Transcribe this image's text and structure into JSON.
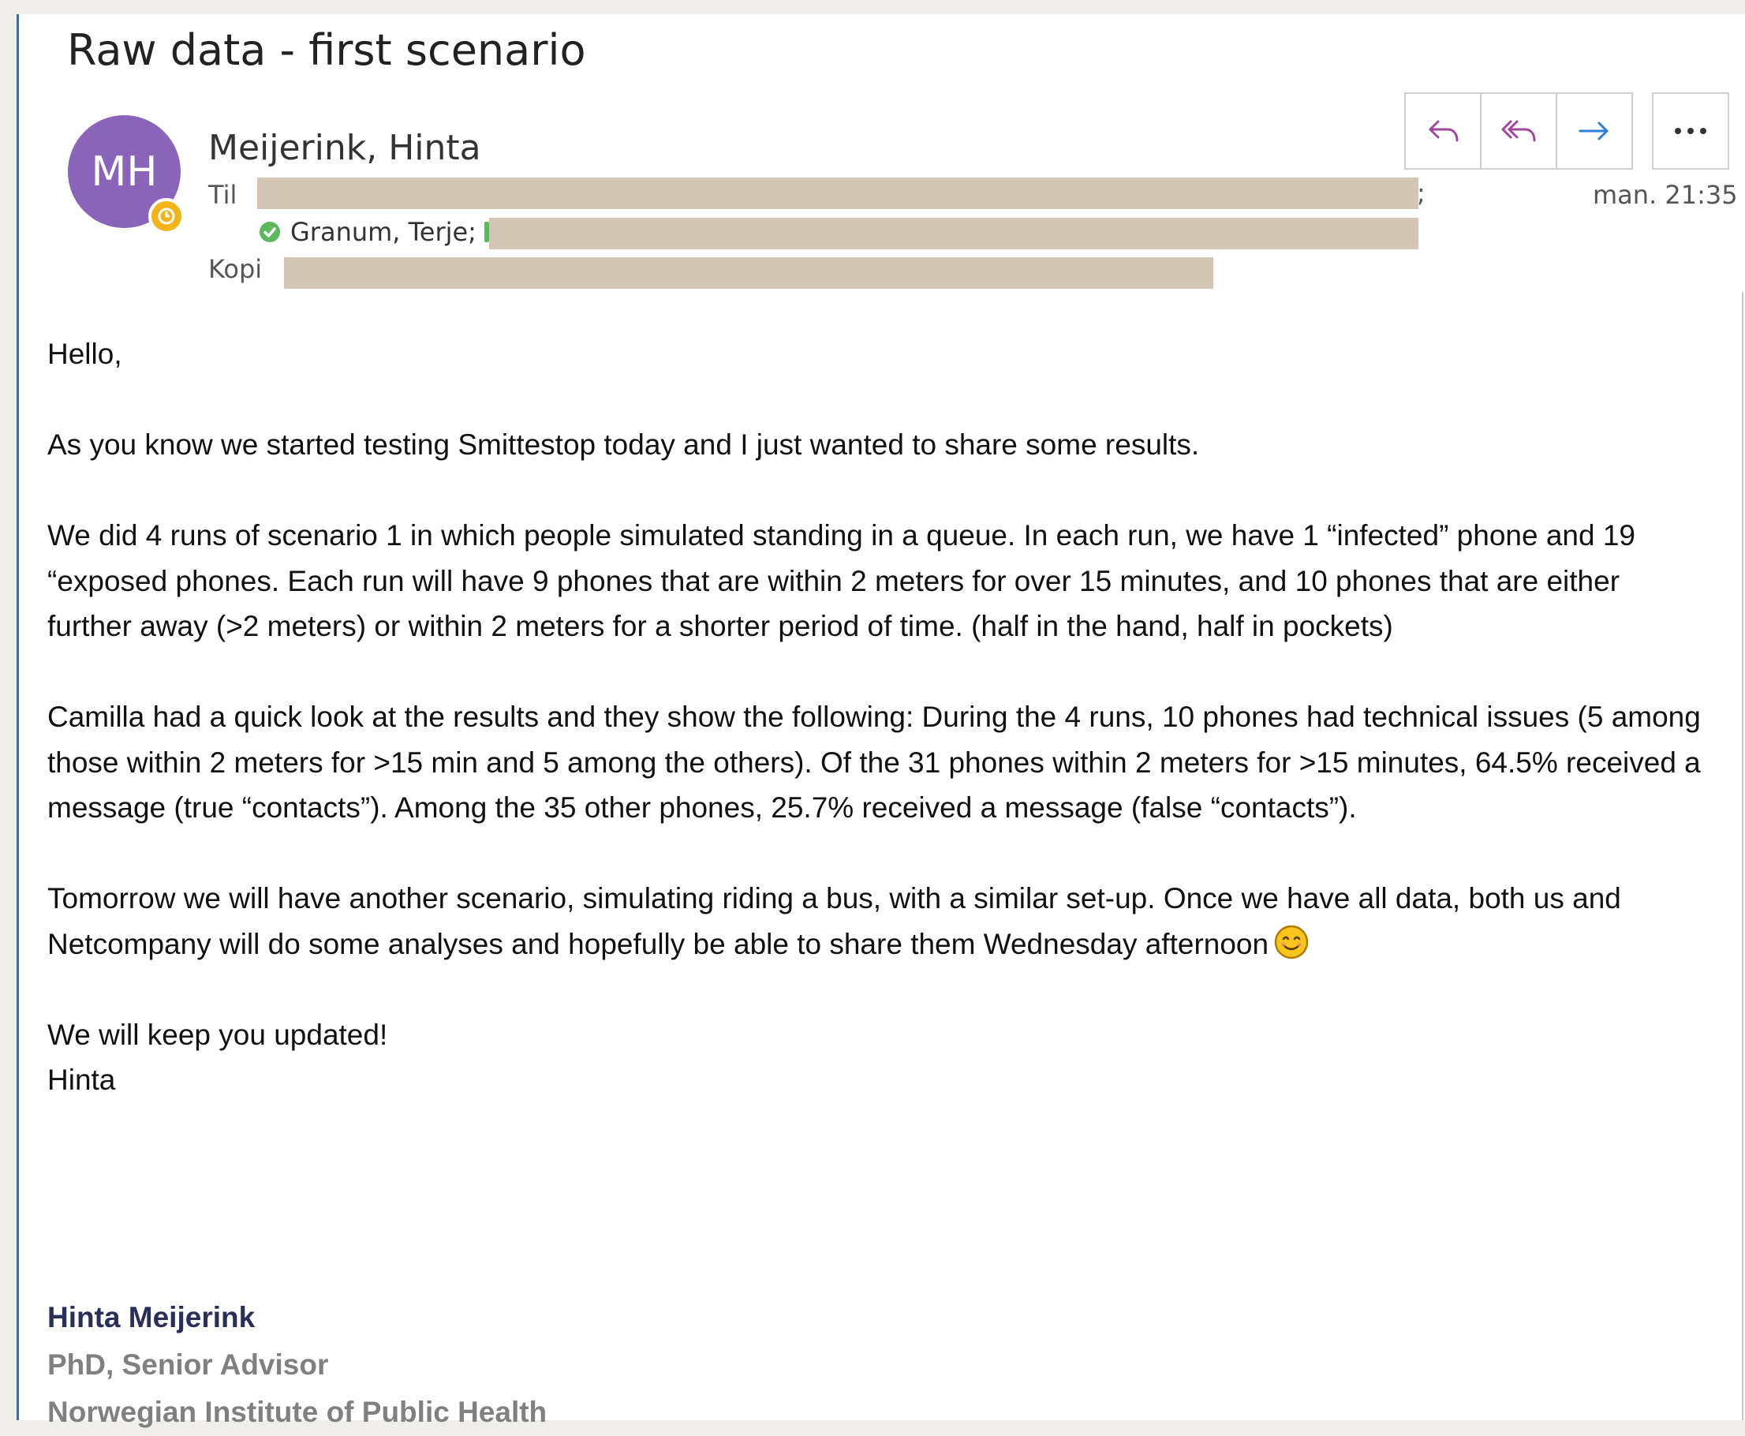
{
  "email": {
    "subject": "Raw data - first scenario",
    "avatar_initials": "MH",
    "sender": "Meijerink, Hinta",
    "to_label": "Til",
    "cc_label": "Kopi",
    "recipient_visible": "Granum, Terje;",
    "to_separator": ";",
    "date": "man. 21:35",
    "actions": {
      "reply_icon": "reply-icon",
      "reply_all_icon": "reply-all-icon",
      "forward_icon": "forward-icon",
      "more_icon": "more-options-icon"
    },
    "accent_color": "#8a64b8",
    "action_colors": {
      "reply": "#a0469e",
      "reply_all": "#a0469e",
      "forward": "#2b7fd4"
    }
  },
  "body": {
    "greeting": "Hello,",
    "p1": "As you know we started testing Smittestop today and I just wanted to share some results.",
    "p2": "We did 4 runs of scenario 1 in which people simulated standing in a queue. In each run, we have 1 “infected” phone and 19 “exposed phones. Each run will have 9 phones that are within 2 meters for over 15 minutes, and 10 phones that are either further away (>2 meters) or within 2 meters for a shorter period of time. (half in the hand, half in pockets)",
    "p3": "Camilla had a quick look at the results and they show the following: During the 4 runs, 10 phones had technical issues (5 among those within 2 meters for >15 min and 5 among the others). Of the 31 phones within 2 meters for >15 minutes, 64.5% received a message (true “contacts”). Among the 35 other phones, 25.7% received a message (false “contacts”).",
    "p4": "Tomorrow we will have another scenario, simulating riding a bus, with a similar set-up. Once we have all data, both us and Netcompany will do some analyses and hopefully be able to share them Wednesday afternoon",
    "closing1": "We will keep you updated!",
    "closing2": "Hinta"
  },
  "signature": {
    "name": "Hinta Meijerink",
    "title": "PhD, Senior Advisor",
    "org": "Norwegian Institute of Public Health"
  }
}
